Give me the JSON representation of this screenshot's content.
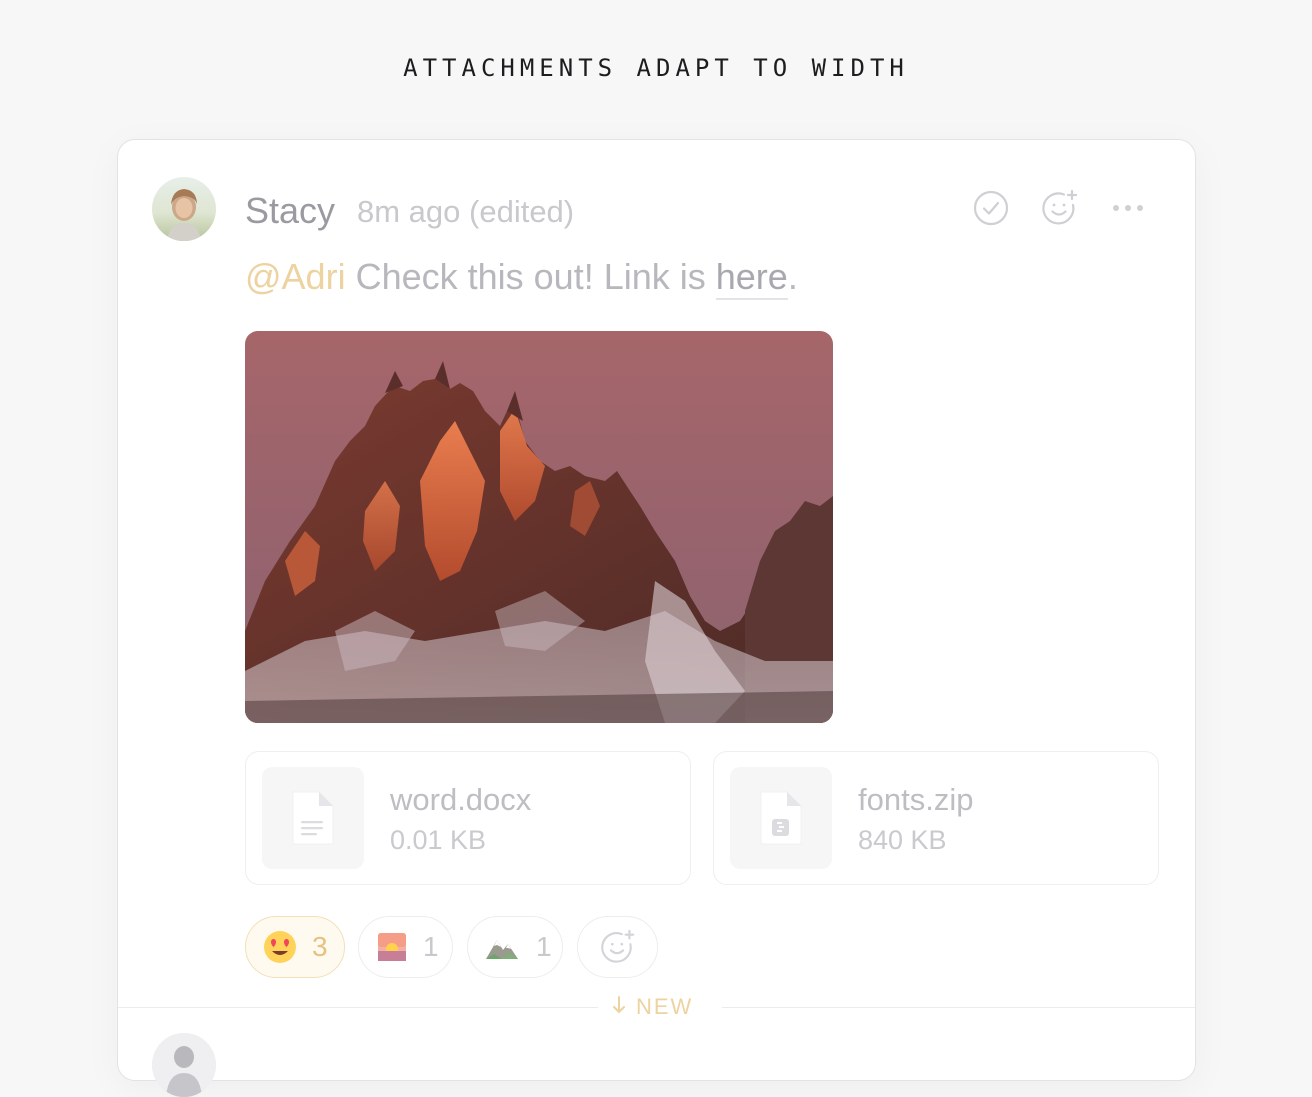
{
  "heading": "ATTACHMENTS ADAPT TO WIDTH",
  "message": {
    "author": "Stacy",
    "timestamp": "8m ago (edited)",
    "mention": "@Adri",
    "text_before_link": " Check this out! Link is ",
    "link_text": "here",
    "text_after_link": ".",
    "actions": [
      {
        "name": "resolve",
        "icon": "check-circle-icon"
      },
      {
        "name": "add-reaction",
        "icon": "smiley-plus-icon"
      },
      {
        "name": "more",
        "icon": "more-horizontal-icon"
      }
    ]
  },
  "attachments": {
    "image": {
      "subject": "mountain-peak-at-sunset"
    },
    "files": [
      {
        "name": "word.docx",
        "size": "0.01 KB",
        "icon": "document-icon"
      },
      {
        "name": "fonts.zip",
        "size": "840 KB",
        "icon": "zip-file-icon"
      }
    ]
  },
  "reactions": [
    {
      "emoji": "😍",
      "count": "3",
      "active": true
    },
    {
      "emoji": "🌅",
      "count": "1",
      "active": false
    },
    {
      "emoji": "⛰️",
      "count": "1",
      "active": false
    }
  ],
  "divider": {
    "label": "NEW"
  },
  "colors": {
    "accent": "#ecd3a0",
    "muted_text": "#b7b7bd",
    "background": "#f7f7f8"
  }
}
